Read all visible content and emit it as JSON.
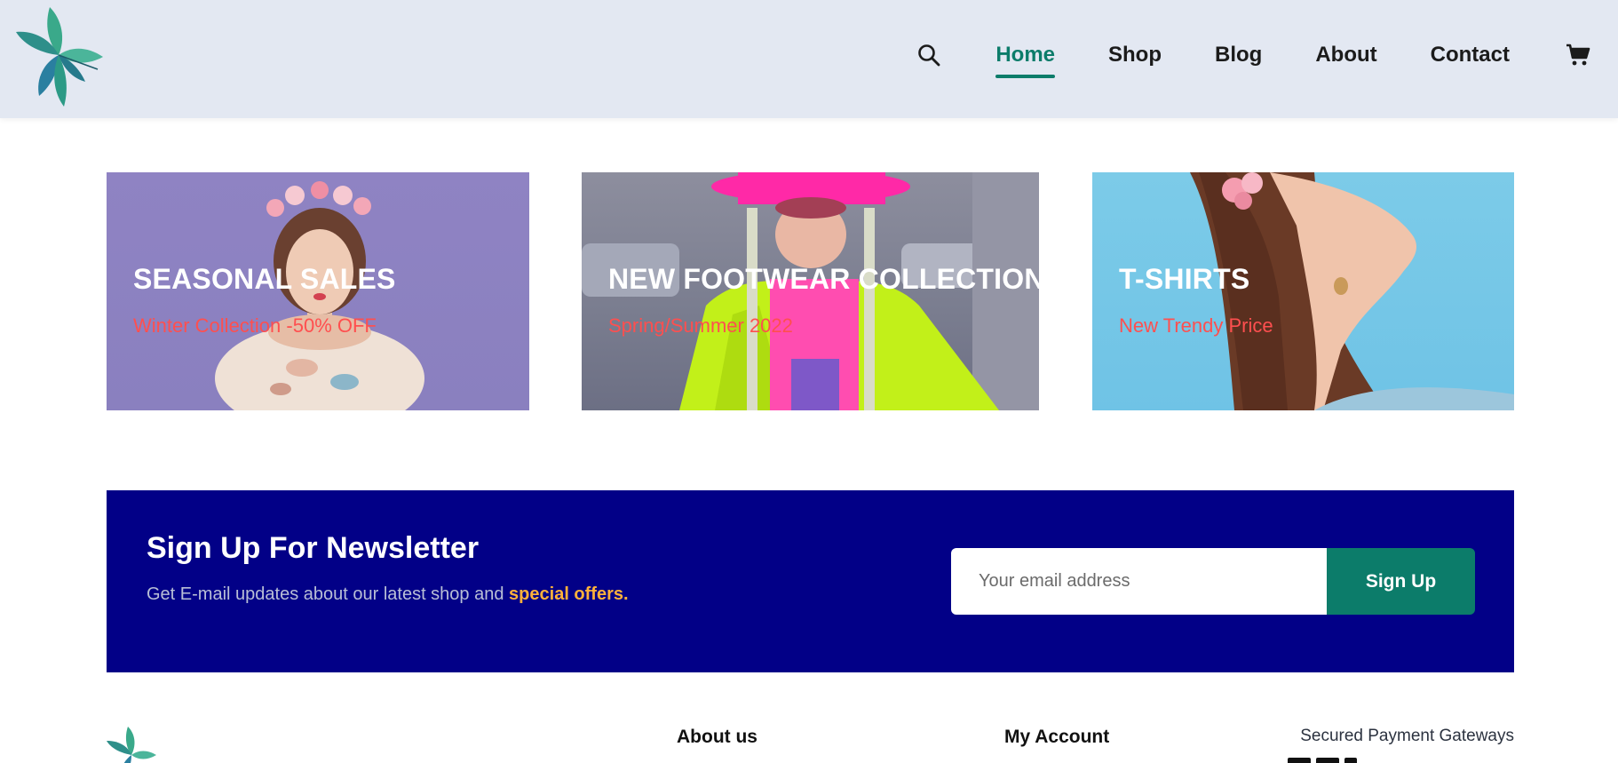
{
  "header": {
    "nav": [
      {
        "label": "Home",
        "active": true
      },
      {
        "label": "Shop",
        "active": false
      },
      {
        "label": "Blog",
        "active": false
      },
      {
        "label": "About",
        "active": false
      },
      {
        "label": "Contact",
        "active": false
      }
    ],
    "icons": {
      "logo": "leaf-logo-icon",
      "search": "search-icon",
      "cart": "cart-icon"
    }
  },
  "banners": [
    {
      "title": "SEASONAL SALES",
      "subtitle": "Winter Collection -50% OFF"
    },
    {
      "title": "NEW FOOTWEAR COLLECTION",
      "subtitle": "Spring/Summer 2022"
    },
    {
      "title": "T-SHIRTS",
      "subtitle": "New Trendy Price"
    }
  ],
  "newsletter": {
    "title": "Sign Up For Newsletter",
    "subtitle_prefix": "Get E-mail updates about our latest shop and",
    "subtitle_highlight": "special offers.",
    "input_placeholder": "Your email address",
    "button_label": "Sign Up"
  },
  "footer": {
    "about_heading": "About us",
    "account_heading": "My Account",
    "payment_heading": "Secured Payment Gateways"
  },
  "colors": {
    "accent": "#0c7c6a",
    "header_bg": "#e3e8f2",
    "newsletter_bg": "#020087",
    "highlight": "#ffb13b",
    "banner_subtitle": "#ff4f4f"
  }
}
